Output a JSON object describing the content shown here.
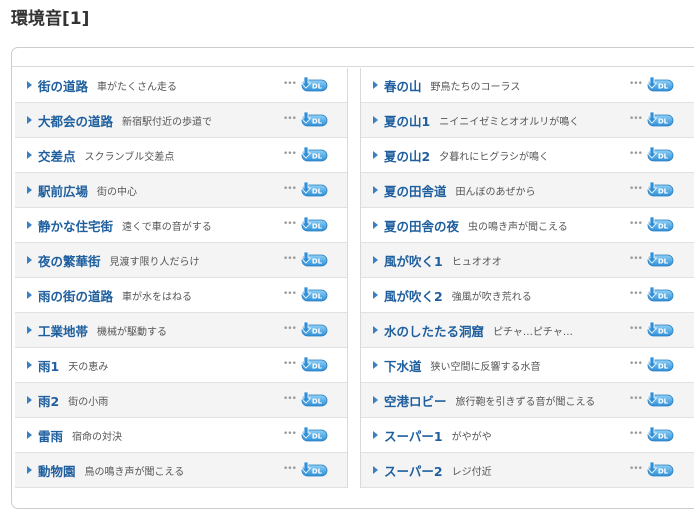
{
  "page": {
    "title": "環境音[1]"
  },
  "download_label": "DL",
  "colors": {
    "link": "#1f5f9e",
    "accent": "#3a7fc4",
    "icon_blue": "#2f8fd8"
  },
  "left_items": [
    {
      "name": "街の道路",
      "desc": "車がたくさん走る"
    },
    {
      "name": "大都会の道路",
      "desc": "新宿駅付近の歩道で"
    },
    {
      "name": "交差点",
      "desc": "スクランブル交差点"
    },
    {
      "name": "駅前広場",
      "desc": "街の中心"
    },
    {
      "name": "静かな住宅街",
      "desc": "遠くで車の音がする"
    },
    {
      "name": "夜の繁華街",
      "desc": "見渡す限り人だらけ"
    },
    {
      "name": "雨の街の道路",
      "desc": "車が水をはねる"
    },
    {
      "name": "工業地帯",
      "desc": "機械が駆動する"
    },
    {
      "name": "雨1",
      "desc": "天の恵み"
    },
    {
      "name": "雨2",
      "desc": "街の小雨"
    },
    {
      "name": "雷雨",
      "desc": "宿命の対決"
    },
    {
      "name": "動物園",
      "desc": "鳥の鳴き声が聞こえる"
    }
  ],
  "right_items": [
    {
      "name": "春の山",
      "desc": "野鳥たちのコーラス"
    },
    {
      "name": "夏の山1",
      "desc": "ニイニイゼミとオオルリが鳴く"
    },
    {
      "name": "夏の山2",
      "desc": "夕暮れにヒグラシが鳴く"
    },
    {
      "name": "夏の田舎道",
      "desc": "田んぼのあぜから"
    },
    {
      "name": "夏の田舎の夜",
      "desc": "虫の鳴き声が聞こえる"
    },
    {
      "name": "風が吹く1",
      "desc": "ヒュオオオ"
    },
    {
      "name": "風が吹く2",
      "desc": "強風が吹き荒れる"
    },
    {
      "name": "水のしたたる洞窟",
      "desc": "ピチャ…ピチャ…"
    },
    {
      "name": "下水道",
      "desc": "狭い空間に反響する水音"
    },
    {
      "name": "空港ロビー",
      "desc": "旅行鞄を引きずる音が聞こえる"
    },
    {
      "name": "スーパー1",
      "desc": "がやがや"
    },
    {
      "name": "スーパー2",
      "desc": "レジ付近"
    }
  ]
}
